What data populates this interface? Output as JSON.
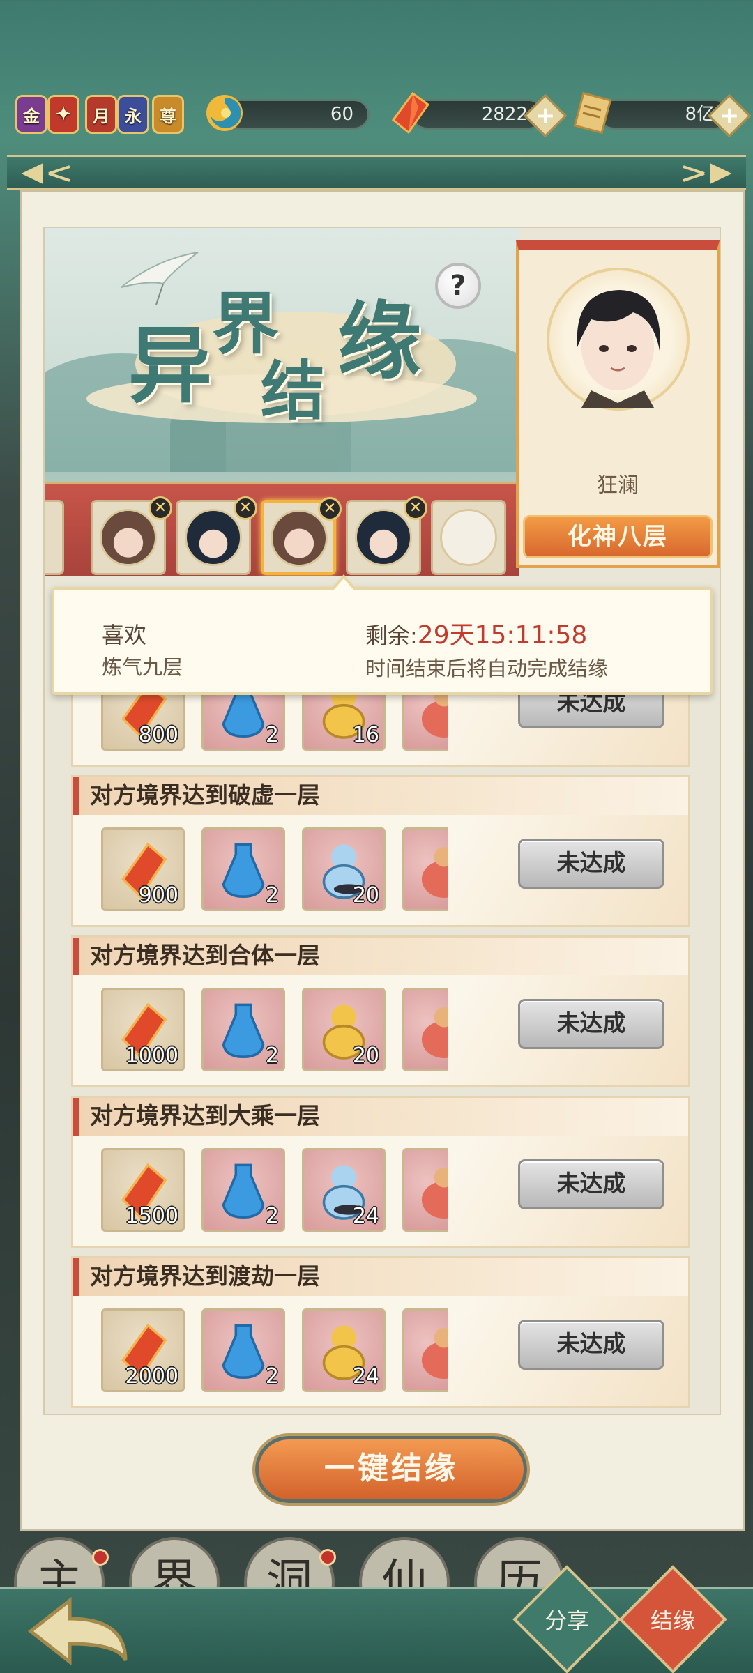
{
  "currency_bar": {
    "badges": [
      {
        "label": "金",
        "color": "#7a3c8e"
      },
      {
        "label": "",
        "color": "#c0392b"
      },
      {
        "label": "月",
        "color": "#b53a2c"
      },
      {
        "label": "永",
        "color": "#3c4d9c"
      },
      {
        "label": "尊",
        "color": "#c98a2a"
      }
    ],
    "spirit": {
      "value": "60",
      "icon": "swirl-icon"
    },
    "gems": {
      "value": "2822",
      "icon": "red-crystal-icon"
    },
    "coins": {
      "value": "8亿",
      "icon": "scroll-icon"
    }
  },
  "banner": {
    "title_chars": [
      "异",
      "界",
      "结",
      "缘"
    ]
  },
  "partner": {
    "name": "狂澜",
    "realm": "化神八层"
  },
  "info": {
    "name": "喜欢",
    "realm": "炼气九层",
    "remaining_label": "剩余:",
    "remaining_time": "29天15:11:58",
    "note": "时间结束后将自动完成结缘"
  },
  "tasks": [
    {
      "title": "",
      "rewards": [
        {
          "qty": "800",
          "icon": "red-crystal-icon"
        },
        {
          "qty": "2",
          "icon": "blue-bottle-icon"
        },
        {
          "qty": "16",
          "icon": "gold-gourd-icon"
        },
        {
          "qty": "",
          "icon": "red-pouch-icon"
        }
      ],
      "status": "未达成"
    },
    {
      "title": "对方境界达到破虚一层",
      "rewards": [
        {
          "qty": "900",
          "icon": "red-crystal-icon"
        },
        {
          "qty": "2",
          "icon": "blue-bottle-icon"
        },
        {
          "qty": "20",
          "icon": "blue-gourd-icon"
        },
        {
          "qty": "",
          "icon": "red-pouch-icon"
        }
      ],
      "status": "未达成"
    },
    {
      "title": "对方境界达到合体一层",
      "rewards": [
        {
          "qty": "1000",
          "icon": "red-crystal-icon"
        },
        {
          "qty": "2",
          "icon": "blue-bottle-icon"
        },
        {
          "qty": "20",
          "icon": "gold-gourd-icon"
        },
        {
          "qty": "",
          "icon": "red-pouch-icon"
        }
      ],
      "status": "未达成"
    },
    {
      "title": "对方境界达到大乘一层",
      "rewards": [
        {
          "qty": "1500",
          "icon": "red-crystal-icon"
        },
        {
          "qty": "2",
          "icon": "blue-bottle-icon"
        },
        {
          "qty": "24",
          "icon": "blue-gourd-icon"
        },
        {
          "qty": "",
          "icon": "red-pouch-icon"
        }
      ],
      "status": "未达成"
    },
    {
      "title": "对方境界达到渡劫一层",
      "rewards": [
        {
          "qty": "2000",
          "icon": "red-crystal-icon"
        },
        {
          "qty": "2",
          "icon": "blue-bottle-icon"
        },
        {
          "qty": "24",
          "icon": "gold-gourd-icon"
        },
        {
          "qty": "",
          "icon": "red-pouch-icon"
        }
      ],
      "status": "未达成"
    }
  ],
  "actions": {
    "one_key": "一键结缘",
    "share": "分享",
    "bond": "结缘"
  },
  "bottom_chars": [
    "主",
    "界",
    "洞",
    "仙",
    "历"
  ]
}
